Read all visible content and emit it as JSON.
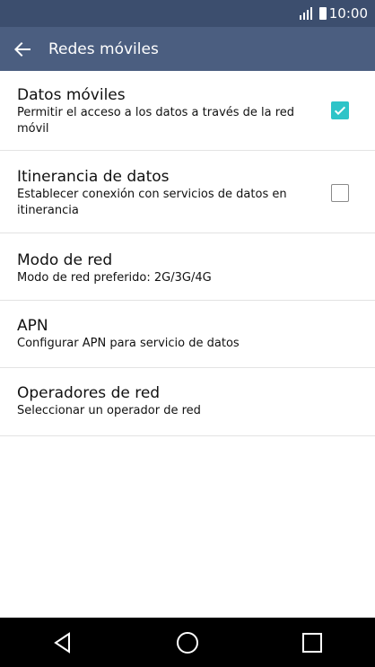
{
  "status_bar": {
    "time": "10:00",
    "signal_icon": "signal-icon",
    "battery_icon": "battery-icon"
  },
  "app_bar": {
    "title": "Redes móviles",
    "back_icon": "back-arrow-icon"
  },
  "settings": [
    {
      "title": "Datos móviles",
      "subtitle": "Permitir el acceso a los datos a través de la red móvil",
      "checkbox": true
    },
    {
      "title": "Itinerancia de datos",
      "subtitle": "Establecer conexión con servicios de datos en itinerancia",
      "checkbox": false
    },
    {
      "title": "Modo de red",
      "subtitle": "Modo de red preferido: 2G/3G/4G"
    },
    {
      "title": "APN",
      "subtitle": "Configurar APN para servicio de datos"
    },
    {
      "title": "Operadores de red",
      "subtitle": "Seleccionar un operador de red"
    }
  ],
  "nav_bar": {
    "back_icon": "nav-back-icon",
    "home_icon": "nav-home-icon",
    "recents_icon": "nav-recents-icon"
  },
  "colors": {
    "status_bar": "#3c4e6e",
    "app_bar": "#4b5e80",
    "checkbox_accent": "#2ec4c8",
    "nav_bar": "#000000"
  }
}
